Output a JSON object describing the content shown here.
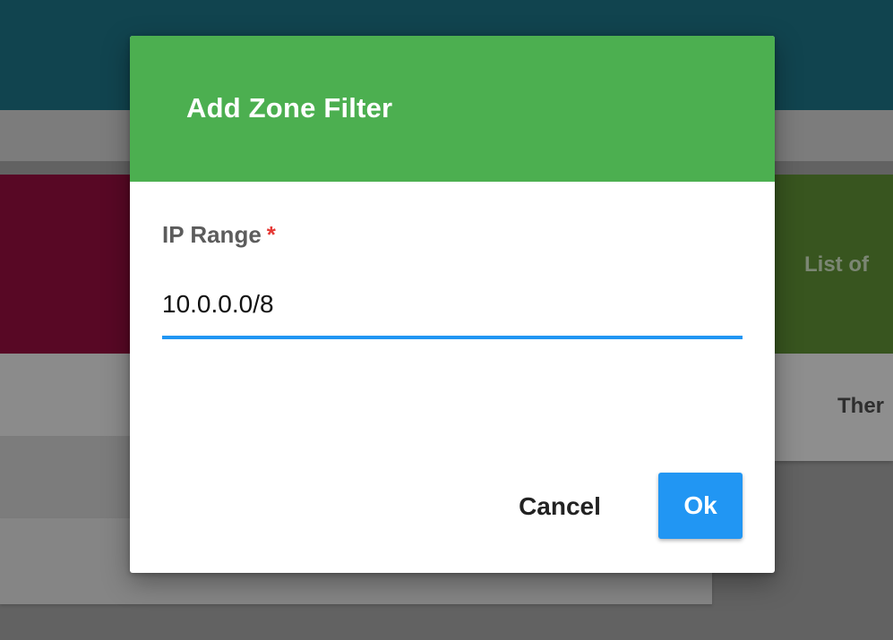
{
  "background": {
    "card_green_title": "List of",
    "panel_right_text": "Ther"
  },
  "dialog": {
    "title": "Add Zone Filter",
    "field": {
      "label": "IP Range",
      "required_mark": "*",
      "value": "10.0.0.0/8"
    },
    "buttons": {
      "cancel_label": "Cancel",
      "ok_label": "Ok"
    }
  },
  "colors": {
    "header_green": "#4caf50",
    "accent_blue": "#2196f3",
    "required_red": "#e53935",
    "background_topbar": "#1c6e80",
    "background_card_red": "#8f0e3d",
    "background_card_green": "#5b8a33"
  }
}
